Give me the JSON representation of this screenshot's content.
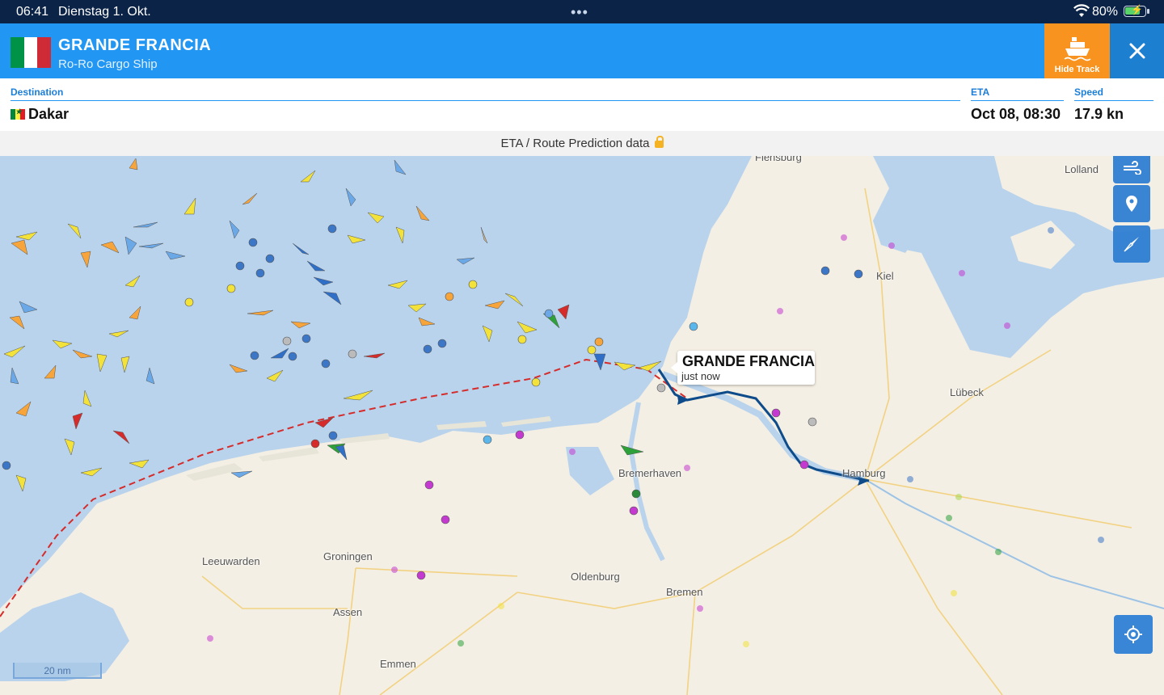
{
  "status_bar": {
    "time": "06:41",
    "date": "Dienstag 1. Okt.",
    "dots": "•••",
    "battery": "80%"
  },
  "vessel": {
    "name": "GRANDE FRANCIA",
    "type": "Ro-Ro Cargo Ship",
    "flag_colors": [
      "#009246",
      "#ffffff",
      "#ce2b37"
    ]
  },
  "toolbar": {
    "hide_track_label": "Hide Track",
    "accent_color": "#f7931e",
    "header_color": "#2196f3"
  },
  "voyage": {
    "destination_label": "Destination",
    "destination": "Dakar",
    "eta_label": "ETA",
    "eta": "Oct 08, 08:30",
    "speed_label": "Speed",
    "speed": "17.9 kn"
  },
  "prediction_bar": {
    "text": "ETA / Route Prediction data"
  },
  "map": {
    "cities": {
      "flensburg": "Flensburg",
      "lolland": "Lolland",
      "kiel": "Kiel",
      "lubeck": "Lübeck",
      "hamburg": "Hamburg",
      "bremerhaven": "Bremerhaven",
      "bremen": "Bremen",
      "oldenburg": "Oldenburg",
      "groningen": "Groningen",
      "leeuwarden": "Leeuwarden",
      "assen": "Assen",
      "emmen": "Emmen"
    },
    "callout": {
      "name": "GRANDE FRANCIA",
      "time": "just now"
    },
    "scale": "20 nm",
    "controls": [
      "wind-icon",
      "pin-icon",
      "compass-icon",
      "locate-icon"
    ]
  }
}
